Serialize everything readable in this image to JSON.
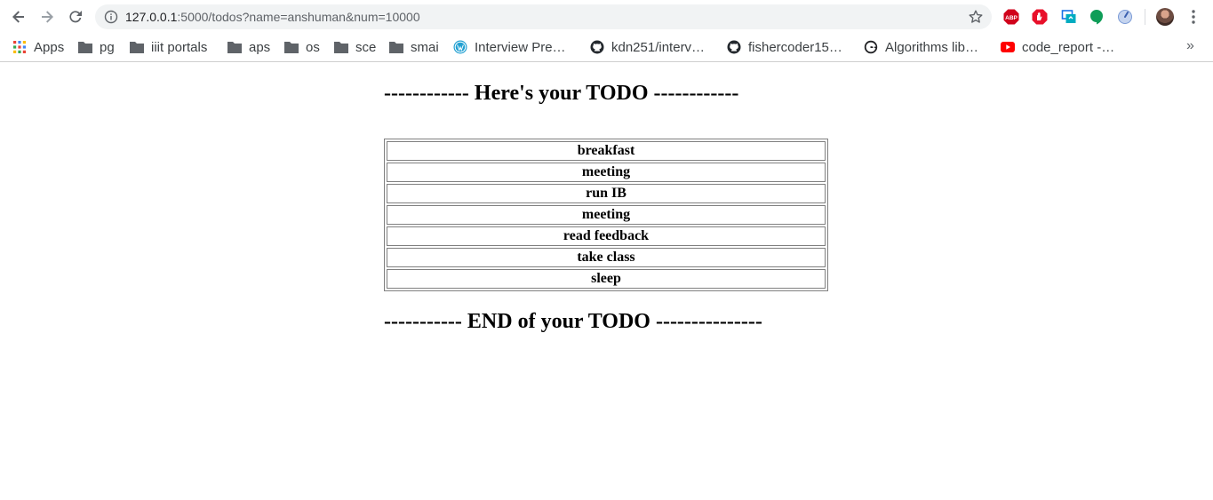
{
  "browser": {
    "url_host": "127.0.0.1",
    "url_rest": ":5000/todos?name=anshuman&num=10000",
    "bookmarks": [
      {
        "label": "Apps",
        "icon": "apps-grid-icon"
      },
      {
        "label": "pg",
        "icon": "folder-icon"
      },
      {
        "label": "iiit portals",
        "icon": "folder-icon"
      },
      {
        "label": "aps",
        "icon": "folder-icon"
      },
      {
        "label": "os",
        "icon": "folder-icon"
      },
      {
        "label": "sce",
        "icon": "folder-icon"
      },
      {
        "label": "smai",
        "icon": "folder-icon"
      },
      {
        "label": "Interview Pre…",
        "icon": "wordpress-icon"
      },
      {
        "label": "kdn251/interv…",
        "icon": "github-icon"
      },
      {
        "label": "fishercoder15…",
        "icon": "github-icon"
      },
      {
        "label": "Algorithms lib…",
        "icon": "google-plus-icon"
      },
      {
        "label": "code_report -…",
        "icon": "youtube-icon"
      }
    ],
    "more_label": "»",
    "colors": {
      "abp_red": "#d0021b",
      "youtube_red": "#ff0000",
      "hangouts_green": "#0f9d58"
    }
  },
  "page": {
    "heading_top": "------------ Here's your TODO ------------",
    "todos": [
      "breakfast",
      "meeting",
      "run IB",
      "meeting",
      "read feedback",
      "take class",
      "sleep"
    ],
    "heading_bottom": "----------- END of your TODO ---------------"
  }
}
